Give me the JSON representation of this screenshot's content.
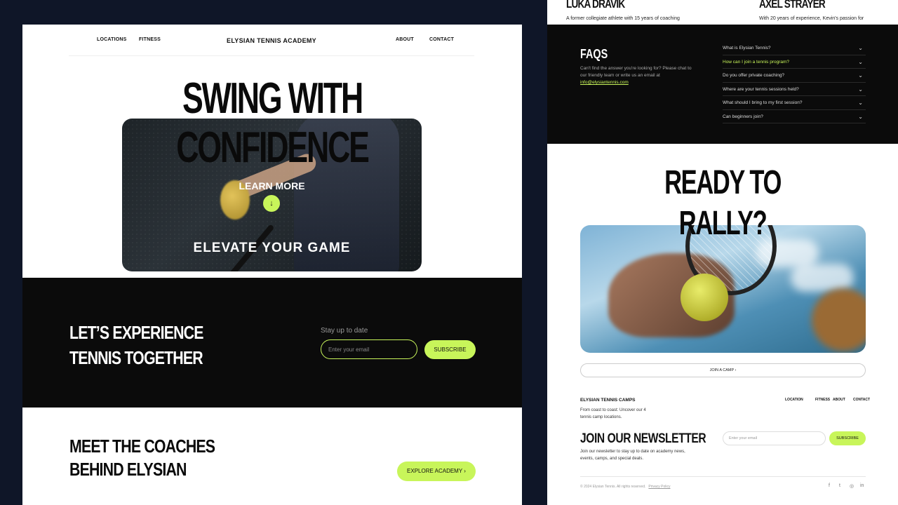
{
  "left": {
    "nav": {
      "locations": "LOCATIONS",
      "fitness": "FITNESS",
      "brand": "ELYSIAN TENNIS ACADEMY",
      "about": "ABOUT",
      "contact": "CONTACT"
    },
    "hero": {
      "title_line1": "SWING WITH",
      "title_line2": "CONFIDENCE",
      "learn_more": "LEARN MORE",
      "arrow": "↓",
      "tagline": "ELEVATE YOUR GAME"
    },
    "subscribe_band": {
      "heading": "LET’S EXPERIENCE TENNIS TOGETHER",
      "stay_label": "Stay up to date",
      "email_placeholder": "Enter your email",
      "button": "SUBSCRIBE"
    },
    "coaches": {
      "heading": "MEET THE COACHES BEHIND ELYSIAN",
      "button": "EXPLORE ACADEMY  ›"
    }
  },
  "right": {
    "coaches_strip": [
      {
        "name": "LUKA DRAVIK",
        "desc": "A former collegiate athlete with 15 years of coaching"
      },
      {
        "name": "AXEL STRAYER",
        "desc": "With 20 years of experience, Kevin's passion for"
      }
    ],
    "faq": {
      "title": "FAQS",
      "intro": "Can't find the answer you're looking for? Please chat to our friendly team or write us an email at",
      "email": "info@elysiantennis.com",
      "items": [
        "What is Elysian Tennis?",
        "How can I join a tennis program?",
        "Do you offer private coaching?",
        "Where are your tennis sessions held?",
        "What should I bring to my first session?",
        "Can beginners join?"
      ],
      "active_index": 1,
      "chevron": "⌄"
    },
    "cta": {
      "line1": "READY TO",
      "line2": "RALLY?",
      "button": "JOIN A CAMP  ›"
    },
    "footer": {
      "brand": "ELYSIAN TENNIS CAMPS",
      "desc": "From coast to coast: Uncover our 4 tennis camp locations.",
      "links": [
        "LOCATION",
        "FITNESS",
        "ABOUT",
        "CONTACT"
      ],
      "newsletter_title": "JOIN OUR NEWSLETTER",
      "newsletter_desc": "Join our newsletter to stay up to date on academy news, events, camps, and special deals.",
      "email_placeholder": "Enter your email",
      "subscribe": "SUBSCRIBE",
      "copyright": "© 2024 Elysian Tennis. All rights reserved.",
      "privacy": "Privacy Policy",
      "socials": [
        "f",
        "t",
        "◎",
        "in"
      ]
    }
  },
  "colors": {
    "accent": "#c8f55a",
    "dark": "#0b0b0b",
    "page_bg": "#0f1628"
  }
}
